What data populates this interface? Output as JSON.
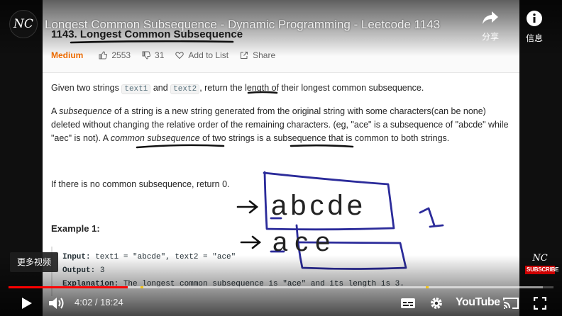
{
  "video": {
    "title": "Longest Common Subsequence - Dynamic Programming - Leetcode 1143",
    "channel_logo": "NC",
    "share_label": "分享",
    "info_label": "信息",
    "more_videos_label": "更多视频",
    "watermark_logo": "NC",
    "subscribe_label": "SUBSCRIBE",
    "time_current": "4:02",
    "time_total": "18:24",
    "time_sep": " / ",
    "played_fraction": 0.219,
    "buffered_fraction": 0.98,
    "youtube_label": "YouTube"
  },
  "problem": {
    "title": "1143. Longest Common Subsequence",
    "difficulty": "Medium",
    "likes": "2553",
    "dislikes": "31",
    "add_to_list": "Add to List",
    "share": "Share",
    "p1_a": "Given two strings ",
    "p1_code1": "text1",
    "p1_b": " and ",
    "p1_code2": "text2",
    "p1_c": ", return the length of their longest common subsequence.",
    "p2_a": "A ",
    "p2_em1": "subsequence",
    "p2_b": " of a string is a new string generated from the original string with some characters(can be none) deleted without changing the relative order of the remaining characters. (eg, \"ace\" is a subsequence of \"abcde\" while \"aec\" is not). A ",
    "p2_em2": "common subsequence",
    "p2_c": " of two strings is a subsequence that is common to both strings.",
    "p3": "If there is no common subsequence, return 0.",
    "example_title": "Example 1:",
    "ex_input_label": "Input:",
    "ex_input": " text1 = \"abcde\", text2 = \"ace\"",
    "ex_output_label": "Output:",
    "ex_output": " 3",
    "ex_expl_label": "Explanation:",
    "ex_expl": " The longest common subsequence is \"ace\" and its length is 3."
  },
  "annotation": {
    "string1": "abcde",
    "string2": "ace",
    "answer": "1",
    "ink_color": "#2b2b9a",
    "ink_dark": "#111111"
  },
  "colors": {
    "accent_red": "#ff0000",
    "difficulty": "#ef6c00",
    "chapter_marker": "#f5c518"
  }
}
